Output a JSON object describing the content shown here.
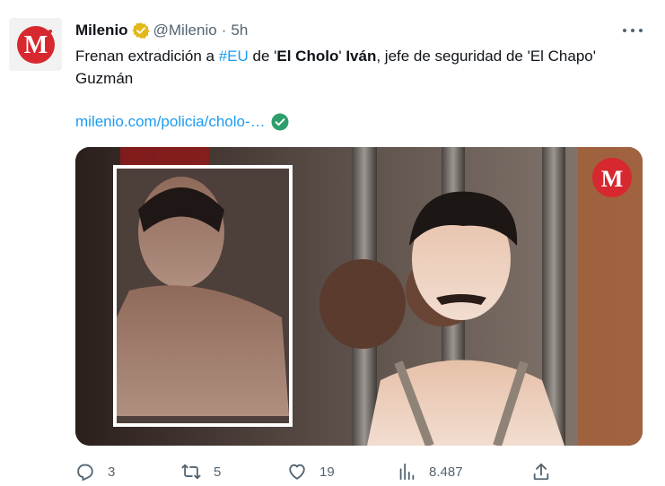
{
  "tweet": {
    "author": {
      "name": "Milenio",
      "handle": "@Milenio",
      "separator": "·",
      "time": "5h",
      "verified": true,
      "avatar_icon": "milenio-logo-icon",
      "avatar_letter": "M"
    },
    "text": {
      "part1": "Frenan extradición a ",
      "hashtag": "#EU",
      "part2": " de '",
      "bold1": "El Cholo",
      "part3": "' ",
      "bold2": "Iván",
      "part4": ", jefe de seguridad de 'El Chapo' Guzmán"
    },
    "link": {
      "text": "milenio.com/policia/cholo-…",
      "icon": "verified-link-check-icon"
    },
    "media": {
      "watermark_letter": "M",
      "brand_color": "#d7282f"
    },
    "actions": {
      "reply": {
        "icon": "reply-icon",
        "count": "3"
      },
      "retweet": {
        "icon": "retweet-icon",
        "count": "5"
      },
      "like": {
        "icon": "heart-icon",
        "count": "19"
      },
      "views": {
        "icon": "views-chart-icon",
        "count": "8.487"
      },
      "share": {
        "icon": "share-icon"
      }
    }
  },
  "colors": {
    "accent": "#1d9bf0",
    "verified_gold": "#e2b719",
    "secondary_text": "#536471",
    "link_check": "#2c9f6c"
  }
}
